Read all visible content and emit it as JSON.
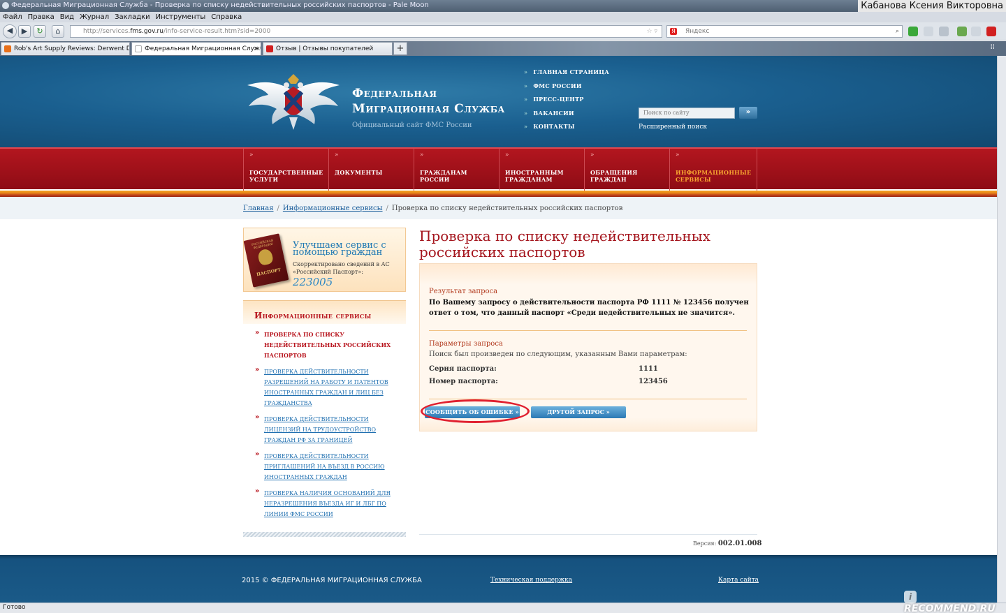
{
  "browser": {
    "window_title": "Федеральная Миграционная Служба - Проверка по списку недействительных российских паспортов - Pale Moon",
    "user_name": "Кабанова Ксения Викторовна",
    "menu": [
      "Файл",
      "Правка",
      "Вид",
      "Журнал",
      "Закладки",
      "Инструменты",
      "Справка"
    ],
    "url_prefix": "http://services.",
    "url_domain": "fms.gov.ru",
    "url_path": "/info-service-result.htm?sid=2000",
    "search_placeholder": "Яндекс",
    "tabs": [
      {
        "label": "Rob's Art Supply Reviews: Derwent Draw...",
        "active": false,
        "icon_color": "#e8701a"
      },
      {
        "label": "Федеральная Миграционная Служба -...",
        "active": true,
        "icon_color": "#ffffff"
      },
      {
        "label": "Отзыв | Отзывы покупателей",
        "active": false,
        "icon_color": "#d12020"
      }
    ],
    "new_tab": "+",
    "status": "Готово"
  },
  "site": {
    "title_line1": "Федеральная",
    "title_line2": "Миграционная Служба",
    "subtitle": "Официальный сайт ФМС России",
    "top_nav": [
      "ГЛАВНАЯ СТРАНИЦА",
      "ФМС РОССИИ",
      "ПРЕСС-ЦЕНТР",
      "ВАКАНСИИ",
      "КОНТАКТЫ"
    ],
    "search_placeholder": "Поиск по сайту",
    "search_button": "»",
    "advanced_search": "Расширенный поиск",
    "main_nav": [
      {
        "label": "ГОСУДАРСТВЕННЫЕ УСЛУГИ",
        "active": false
      },
      {
        "label": "ДОКУМЕНТЫ",
        "active": false
      },
      {
        "label": "ГРАЖДАНАМ РОССИИ",
        "active": false
      },
      {
        "label": "ИНОСТРАННЫМ ГРАЖДАНАМ",
        "active": false
      },
      {
        "label": "ОБРАЩЕНИЯ ГРАЖДАН",
        "active": false
      },
      {
        "label": "ИНФОРМАЦИОННЫЕ СЕРВИСЫ",
        "active": true
      }
    ],
    "breadcrumb": {
      "home": "Главная",
      "section": "Информационные сервисы",
      "current": "Проверка по списку недействительных российских паспортов"
    }
  },
  "promo": {
    "passport_caption": "РОССИЙСКАЯ ФЕДЕРАЦИЯ",
    "passport_word": "ПАСПОРТ",
    "title": "Улучшаем сервис с помощью граждан",
    "text": "Скорректировано сведений в АС «Российский Паспорт»:",
    "count": "223005"
  },
  "services": {
    "title": "Информационные сервисы",
    "items": [
      {
        "label": "ПРОВЕРКА ПО СПИСКУ НЕДЕЙСТВИТЕЛЬНЫХ РОССИЙСКИХ ПАСПОРТОВ",
        "current": true
      },
      {
        "label": "ПРОВЕРКА ДЕЙСТВИТЕЛЬНОСТИ РАЗРЕШЕНИЙ НА РАБОТУ И ПАТЕНТОВ ИНОСТРАННЫХ ГРАЖДАН И ЛИЦ БЕЗ ГРАЖДАНСТВА",
        "current": false
      },
      {
        "label": "ПРОВЕРКА ДЕЙСТВИТЕЛЬНОСТИ ЛИЦЕНЗИЙ НА ТРУДОУСТРОЙСТВО ГРАЖДАН РФ ЗА ГРАНИЦЕЙ",
        "current": false
      },
      {
        "label": "ПРОВЕРКА ДЕЙСТВИТЕЛЬНОСТИ ПРИГЛАШЕНИЙ НА ВЪЕЗД В РОССИЮ ИНОСТРАННЫХ ГРАЖДАН",
        "current": false
      },
      {
        "label": "ПРОВЕРКА НАЛИЧИЯ ОСНОВАНИЙ ДЛЯ НЕРАЗРЕШЕНИЯ ВЪЕЗДА ИГ И ЛБГ ПО ЛИНИИ ФМС РОССИИ",
        "current": false
      }
    ]
  },
  "main": {
    "title": "Проверка по списку недействительных российских паспортов",
    "result_heading": "Результат запроса",
    "result_text": "По Вашему запросу о действительности паспорта РФ 1111 № 123456 получен ответ о том, что данный паспорт «Среди недействительных не значится».",
    "params_heading": "Параметры запроса",
    "params_text": "Поиск был произведен по следующим, указанным Вами параметрам:",
    "params": [
      {
        "label": "Серия паспорта:",
        "value": "1111"
      },
      {
        "label": "Номер паспорта:",
        "value": "123456"
      }
    ],
    "report_button": "СООБЩИТЬ ОБ ОШИБКЕ »",
    "other_button": "ДРУГОЙ ЗАПРОС »",
    "version_label": "Версия:",
    "version_value": "002.01.008"
  },
  "footer": {
    "copyright": "2015 © ФЕДЕРАЛЬНАЯ МИГРАЦИОННАЯ СЛУЖБА",
    "support": "Техническая поддержка",
    "sitemap": "Карта сайта"
  },
  "watermark": "RECOMMEND.RU",
  "colors": {
    "header_blue": "#1a5f8f",
    "nav_red": "#a3121b",
    "accent_orange": "#f7a531",
    "title_red": "#a5161e",
    "annotation_circle": "#e02030"
  }
}
